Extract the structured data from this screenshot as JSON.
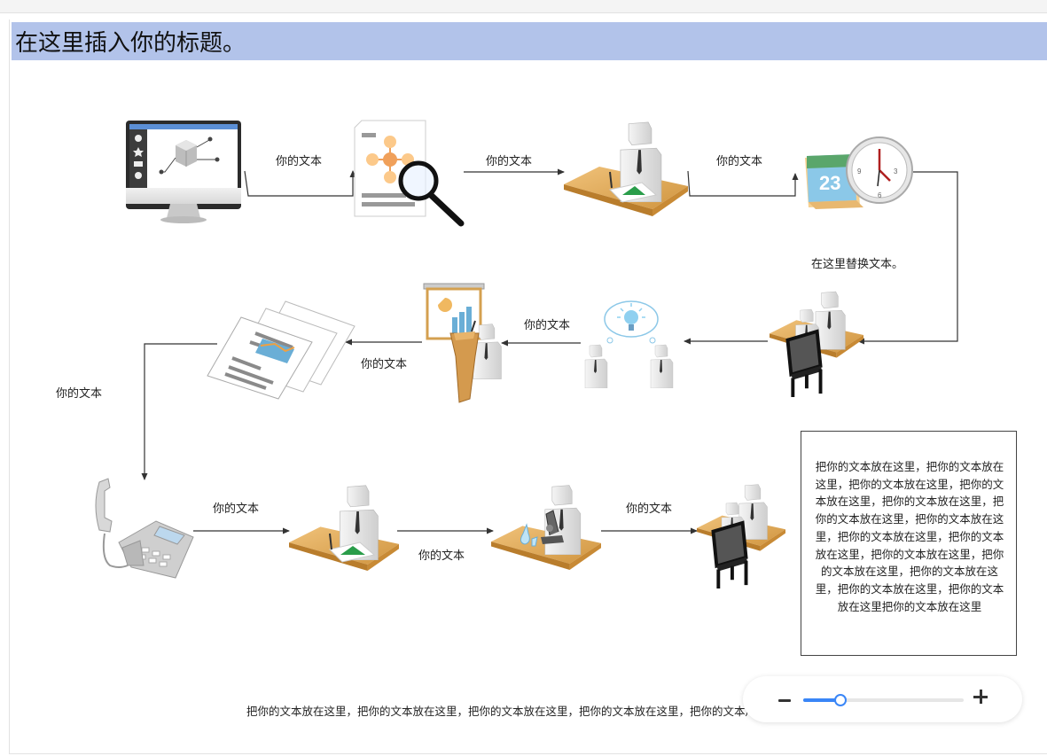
{
  "page": {
    "title": "在这里插入你的标题。"
  },
  "flow": {
    "labels": {
      "r1_a": "你的文本",
      "r1_b": "你的文本",
      "r1_c": "你的文本",
      "r1_side": "在这里替换文本。",
      "r2_a": "你的文本",
      "r2_b": "你的文本",
      "left": "你的文本",
      "r3_a": "你的文本",
      "r3_b": "你的文本",
      "r3_c": "你的文本"
    },
    "icons": [
      "monitor-icon",
      "document-search-icon",
      "person-desk-icon",
      "calendar-clock-icon",
      "meeting-desk-icon",
      "idea-discussion-icon",
      "presenter-chart-icon",
      "reports-icon",
      "telephone-icon",
      "person-desk-icon",
      "lab-microscope-icon",
      "meeting-desk-icon"
    ],
    "calendar_day": "23"
  },
  "textbox": {
    "text": "把你的文本放在这里，把你的文本放在这里，把你的文本放在这里，把你的文本放在这里，把你的文本放在这里，把你的文本放在这里，把你的文本放在这里，把你的文本放在这里，把你的文本放在这里，把你的文本放在这里，把你的文本放在这里，把你的文本放在这里，把你的文本放在这里，把你的文本放在这里把你的文本放在这里"
  },
  "bottom_text": "把你的文本放在这里，把你的文本放在这里，把你的文本放在这里，把你的文本放在这里，把你的文本放在这里",
  "zoom": {
    "level": 0.23
  },
  "colors": {
    "title_bg": "#b2c3ea",
    "accent": "#3a86f7",
    "desk": "#e0a957"
  }
}
